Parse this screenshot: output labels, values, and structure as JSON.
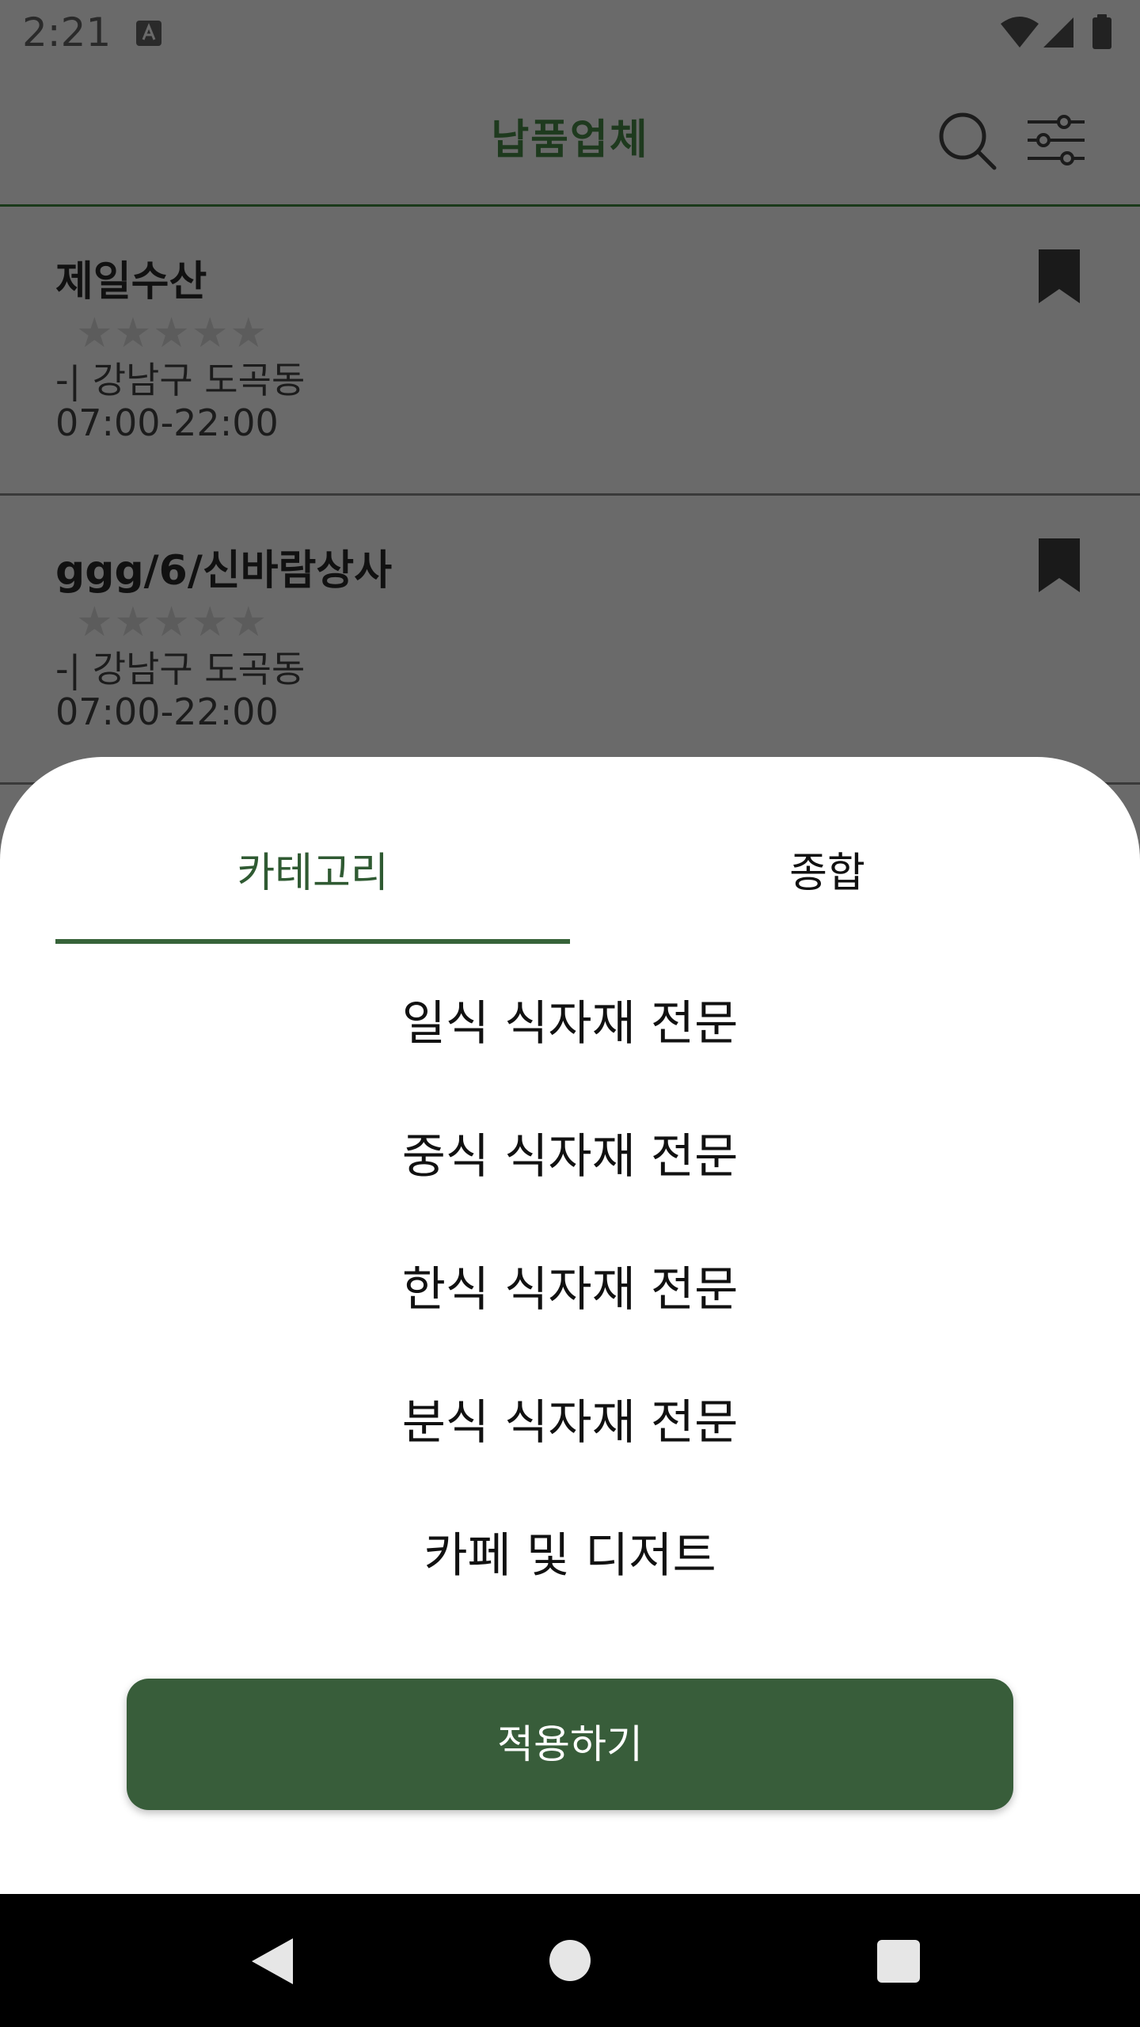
{
  "status_bar": {
    "time": "2:21",
    "icons": [
      "a-keyboard-icon",
      "wifi-icon",
      "signal-icon",
      "battery-icon"
    ]
  },
  "app_bar": {
    "title": "납품업체",
    "icons": [
      "search-icon",
      "filter-sliders-icon"
    ],
    "title_color": "#1e3a1e"
  },
  "vendors": [
    {
      "name": "제일수산",
      "rating": 0,
      "rating_max": 5,
      "address": "-| 강남구 도곡동",
      "hours": "07:00-22:00"
    },
    {
      "name": "ggg/6/신바람상사",
      "rating": 0,
      "rating_max": 5,
      "address": "-| 강남구 도곡동",
      "hours": "07:00-22:00"
    }
  ],
  "sheet": {
    "tabs": [
      {
        "label": "카테고리",
        "selected": true
      },
      {
        "label": "종합",
        "selected": false
      }
    ],
    "categories": [
      "일식 식자재 전문",
      "중식 식자재 전문",
      "한식 식자재 전문",
      "분식 식자재 전문",
      "카페 및 디저트"
    ],
    "apply_label": "적용하기"
  },
  "colors": {
    "accent": "#385d3a",
    "tab_selected_text": "#2f5a32",
    "scrim_background": "#6a6a6a"
  }
}
